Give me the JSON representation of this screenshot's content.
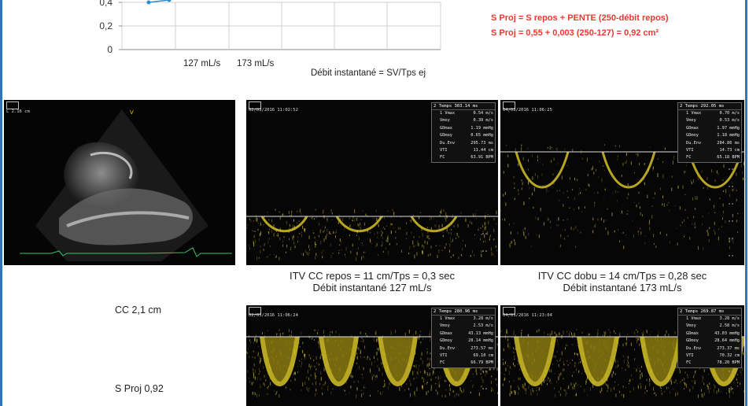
{
  "chart_data": {
    "type": "line",
    "y_ticks": [
      "0,4",
      "0,2",
      "0"
    ],
    "x_labels": [
      "127 mL/s",
      "173 mL/s"
    ],
    "xlabel": "Débit instantané = SV/Tps ej",
    "ylim": [
      0,
      0.4
    ],
    "grid": true,
    "series": [
      {
        "x": [
          1,
          2
        ],
        "y": [
          0.4,
          0.42
        ]
      }
    ],
    "point_color": "#2a8fd4"
  },
  "formula": {
    "line1": "S Proj = S repos + PENTE (250-débit repos)",
    "line2": "S Proj = 0,55 + 0,003 (250-127) = 0,92 cm²",
    "color": "#e8392f"
  },
  "panels": {
    "p1": {
      "header": "L 2.16 cm",
      "marker": "V"
    },
    "p2": {
      "date": "02/03/2016 11:02:52",
      "header": "2 Temps   303.14 ms",
      "rows": [
        [
          "Vmax",
          "0.54 m/s"
        ],
        [
          "Vmoy",
          "0.39 m/s"
        ],
        [
          "GDmax",
          "1.19 mmHg"
        ],
        [
          "GDmoy",
          "0.65 mmHg"
        ],
        [
          "Du.Env",
          "295.73 ms"
        ],
        [
          "VTI",
          "11.44 cm"
        ],
        [
          "FC",
          "63.91 BPM"
        ]
      ],
      "caption1": "ITV CC repos = 11 cm/Tps = 0,3 sec",
      "caption2": "Débit instantané 127 mL/s"
    },
    "p3": {
      "date": "04/03/2016 11:06:25",
      "header": "2 Temps   292.05 ms",
      "rows": [
        [
          "Vmax",
          "0.70 m/s"
        ],
        [
          "Vmoy",
          "0.53 m/s"
        ],
        [
          "GDmax",
          "1.97 mmHg"
        ],
        [
          "GDmoy",
          "1.18 mmHg"
        ],
        [
          "Du.Env",
          "284.86 ms"
        ],
        [
          "VTI",
          "14.73 cm"
        ],
        [
          "FC",
          "65.18 BPM"
        ]
      ],
      "caption1": "ITV CC dobu = 14 cm/Tps = 0,28 sec",
      "caption2": "Débit instantané 173 mL/s"
    },
    "p4": {
      "date": "02/03/2016 11:06:24",
      "header": "2 Temps   280.96 ms",
      "rows": [
        [
          "Vmax",
          "3.28 m/s"
        ],
        [
          "Vmoy",
          "2.53 m/s"
        ],
        [
          "GDmax",
          "43.13 mmHg"
        ],
        [
          "GDmoy",
          "28.14 mmHg"
        ],
        [
          "Du.Env",
          "273.57 ms"
        ],
        [
          "VTI",
          "69.10 cm"
        ],
        [
          "FC",
          "66.79 BPM"
        ]
      ]
    },
    "p5": {
      "date": "04/03/2016 11:23:04",
      "header": "2 Temps   269.87 ms",
      "rows": [
        [
          "Vmax",
          "3.28 m/s"
        ],
        [
          "Vmoy",
          "2.58 m/s"
        ],
        [
          "GDmax",
          "43.03 mmHg"
        ],
        [
          "GDmoy",
          "28.64 mmHg"
        ],
        [
          "Du.Env",
          "273.37 ms"
        ],
        [
          "VTI",
          "70.32 cm"
        ],
        [
          "FC",
          "78.20 BPM"
        ]
      ]
    }
  },
  "labels": {
    "cc": "CC 2,1 cm",
    "sproj": "S Proj 0,92"
  }
}
